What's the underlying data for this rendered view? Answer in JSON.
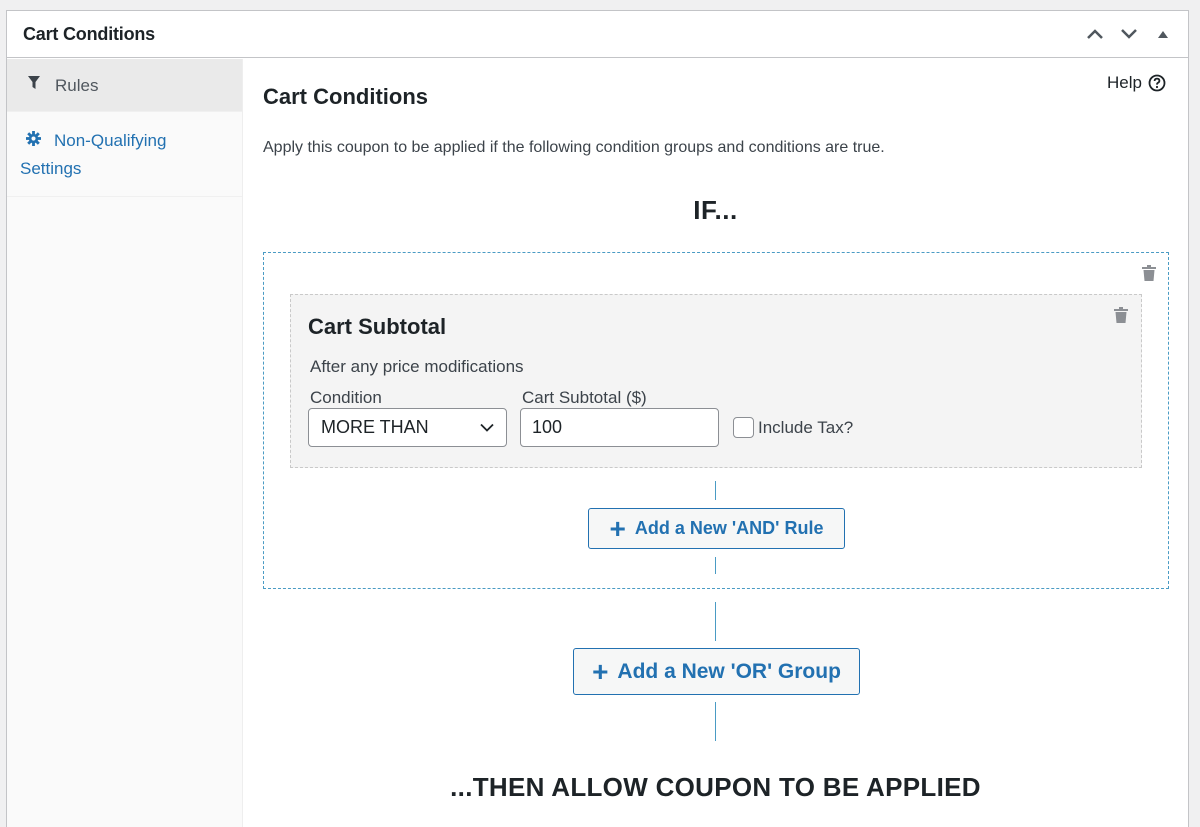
{
  "postbox": {
    "title": "Cart Conditions"
  },
  "sidebar": {
    "tabs": [
      {
        "label": "Rules",
        "icon": "filter-icon",
        "active": true
      },
      {
        "label": "Non-Qualifying",
        "label2": "Settings",
        "icon": "gear-icon",
        "active": false
      }
    ]
  },
  "main": {
    "title": "Cart Conditions",
    "help_label": "Help",
    "description": "Apply this coupon to be applied if the following condition groups and conditions are true.",
    "if_label": "IF...",
    "then_label": "...THEN ALLOW COUPON TO BE APPLIED"
  },
  "rule": {
    "title": "Cart Subtotal",
    "description": "After any price modifications",
    "condition_label": "Condition",
    "condition_value": "MORE THAN",
    "subtotal_label": "Cart Subtotal ($)",
    "subtotal_value": "100",
    "include_tax_label": "Include Tax?",
    "include_tax_checked": false
  },
  "buttons": {
    "add_and": "Add a New 'AND' Rule",
    "add_or": "Add a New 'OR' Group",
    "plus_glyph": "+"
  },
  "colors": {
    "accent": "#2271b1",
    "group_border": "#4a9bc4",
    "rule_bg": "#f4f4f4"
  }
}
